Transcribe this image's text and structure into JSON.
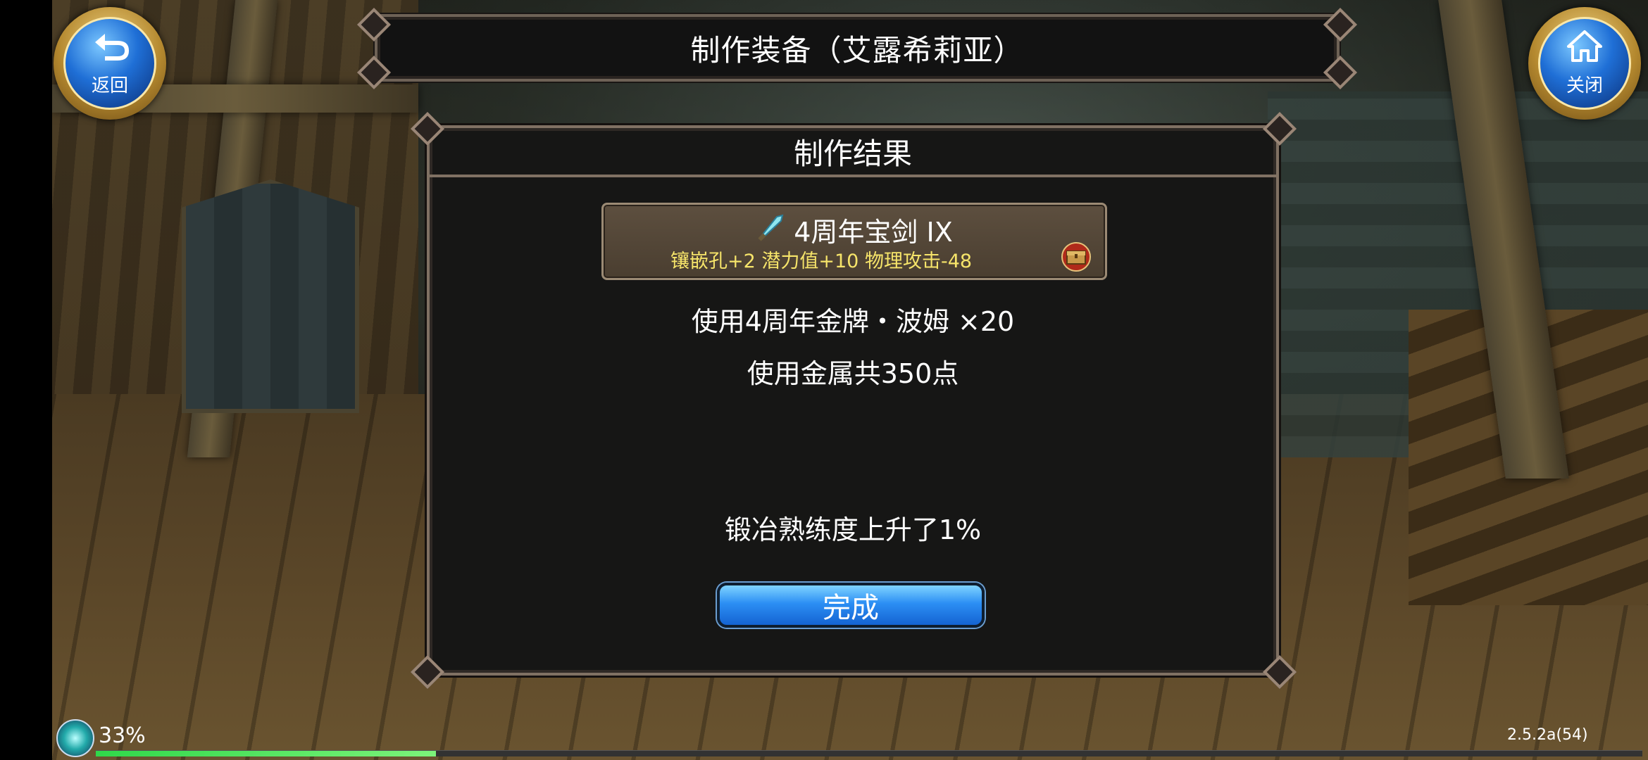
{
  "title": "制作装备（艾露希莉亚）",
  "nav": {
    "back_label": "返回",
    "close_label": "关闭",
    "back_icon": "back-arrow-icon",
    "close_icon": "home-icon"
  },
  "panel": {
    "header": "制作结果",
    "item": {
      "name": "4周年宝剑 IX",
      "stats": "镶嵌孔+2 潜力值+10 物理攻击-48",
      "icon": "sword-icon",
      "extra_icon": "treasure-chest-icon"
    },
    "material_line": "使用4周年金牌・波姆 ×20",
    "metal_line": "使用金属共350点",
    "skill_line": "锻冶熟练度上升了1%",
    "done_label": "完成"
  },
  "status": {
    "battery": "33%",
    "version": "2.5.2a(54)",
    "progress": 0.22
  },
  "colors": {
    "stats_yellow": "#f6e46a",
    "button_blue": "#2c8ff4",
    "progress_green": "#2fd84a"
  }
}
